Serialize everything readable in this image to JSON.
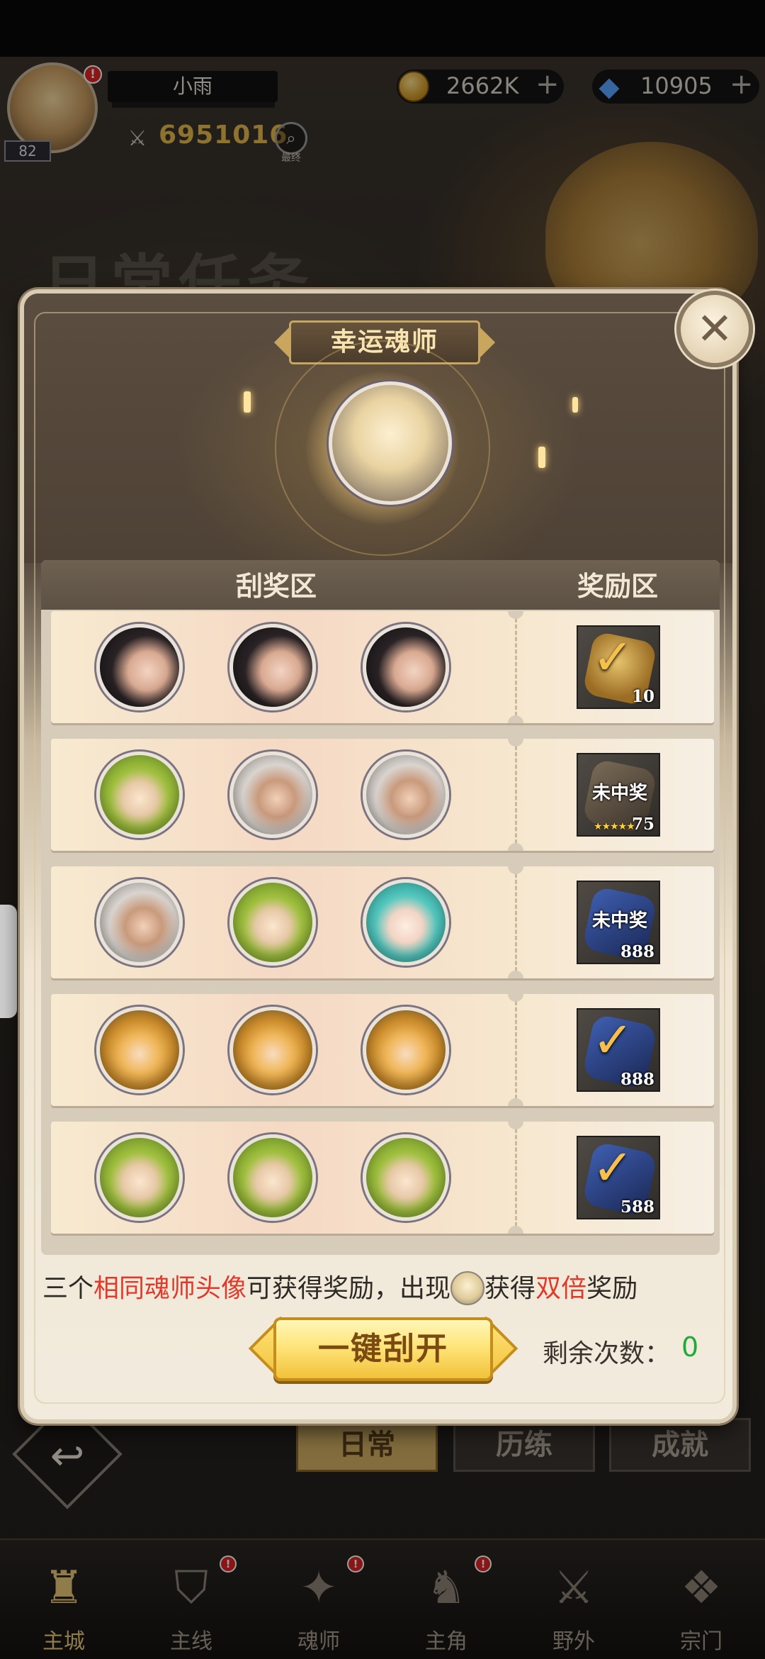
{
  "hud": {
    "player_name": "小雨",
    "level": "82",
    "power": "6951016",
    "notify_badge": "!",
    "zoom_label": "最终",
    "gold": "2662K",
    "gems": "10905",
    "plus": "+"
  },
  "background": {
    "title": "日常任务",
    "tabs": [
      "日常",
      "历练",
      "成就"
    ]
  },
  "nav": {
    "items": [
      {
        "label": "主城",
        "icon": "castle-icon",
        "badge": ""
      },
      {
        "label": "主线",
        "icon": "shield-icon",
        "badge": "!"
      },
      {
        "label": "魂师",
        "icon": "book-icon",
        "badge": "!"
      },
      {
        "label": "主角",
        "icon": "hero-icon",
        "badge": "!"
      },
      {
        "label": "野外",
        "icon": "swords-icon",
        "badge": ""
      },
      {
        "label": "宗门",
        "icon": "emblem-icon",
        "badge": ""
      }
    ]
  },
  "modal": {
    "title": "幸运魂师",
    "close_glyph": "✕",
    "header_scratch": "刮奖区",
    "header_reward": "奖励区",
    "rows": [
      {
        "avatars": [
          "dark-hair-man",
          "dark-hair-man",
          "dark-hair-man"
        ],
        "prize_type": "coin",
        "prize_text": "",
        "qty": "10",
        "won": true,
        "stars": ""
      },
      {
        "avatars": [
          "green-hair-woman",
          "white-hair-man",
          "white-hair-man"
        ],
        "prize_type": "hex-gem",
        "prize_text": "未中奖",
        "qty": "75",
        "won": false,
        "stars": "★★★★★"
      },
      {
        "avatars": [
          "white-hair-man",
          "green-hair-woman",
          "teal-hair-girl"
        ],
        "prize_type": "blue-gem",
        "prize_text": "未中奖",
        "qty": "888",
        "won": false,
        "stars": ""
      },
      {
        "avatars": [
          "hooded-blonde-girl",
          "hooded-blonde-girl",
          "hooded-blonde-girl"
        ],
        "prize_type": "blue-gem",
        "prize_text": "",
        "qty": "888",
        "won": true,
        "stars": ""
      },
      {
        "avatars": [
          "green-hair-woman",
          "green-hair-woman",
          "green-hair-woman"
        ],
        "prize_type": "blue-gem",
        "prize_text": "",
        "qty": "588",
        "won": true,
        "stars": ""
      }
    ],
    "rule": {
      "part1": "三个",
      "highlight1": "相同魂师头像",
      "part2": "可获得奖励，出现",
      "part3": "获得",
      "highlight2": "双倍",
      "part4": "奖励"
    },
    "scratch_button": "一键刮开",
    "remaining_label": "剩余次数：",
    "remaining_value": "0"
  },
  "colors": {
    "highlight_red": "#e03a2c",
    "remaining_green": "#1faa3a",
    "button_gold": "#f2c23a"
  }
}
